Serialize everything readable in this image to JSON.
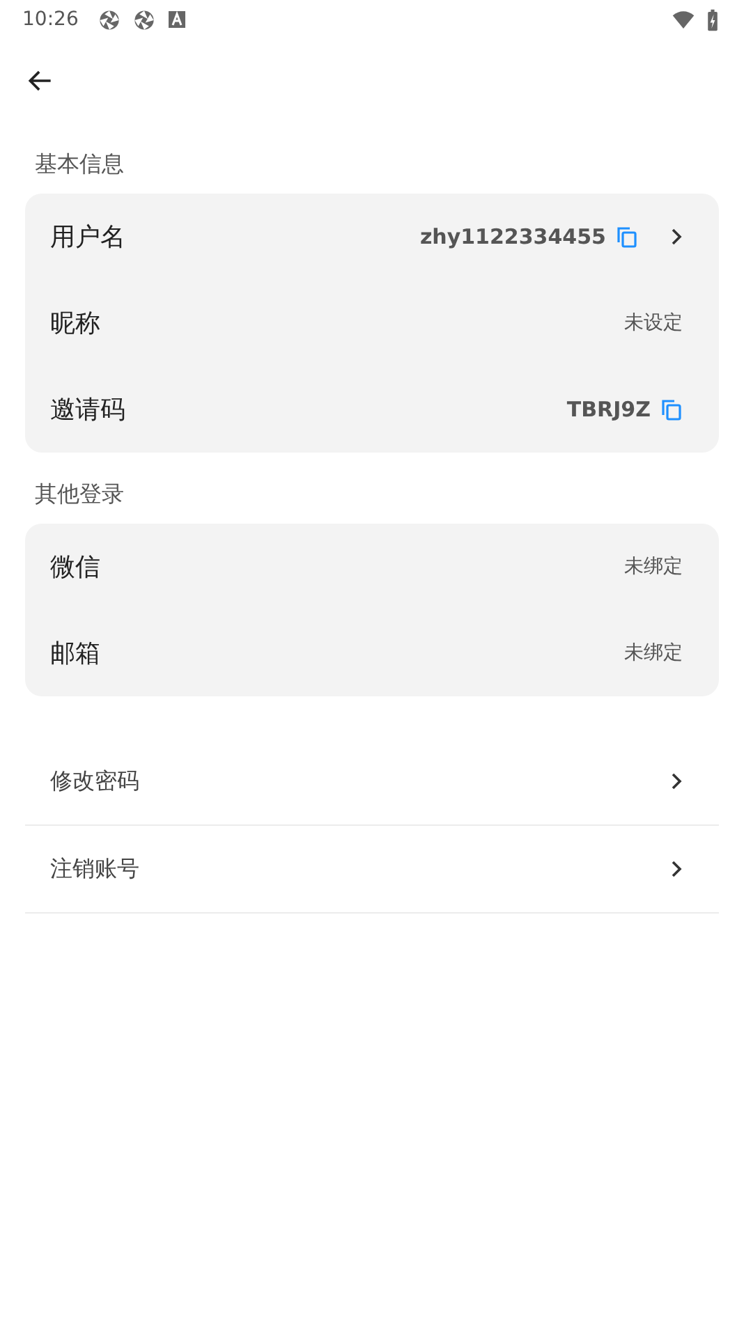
{
  "status_bar": {
    "time": "10:26"
  },
  "sections": [
    {
      "title": "基本信息",
      "rows": [
        {
          "label": "用户名",
          "value": "zhy1122334455",
          "copy": true,
          "chevron": true
        },
        {
          "label": "昵称",
          "value": "未设定",
          "copy": false,
          "chevron": false
        },
        {
          "label": "邀请码",
          "value": "TBRJ9Z",
          "copy": true,
          "chevron": false
        }
      ]
    },
    {
      "title": "其他登录",
      "rows": [
        {
          "label": "微信",
          "value": "未绑定",
          "copy": false,
          "chevron": false
        },
        {
          "label": "邮箱",
          "value": "未绑定",
          "copy": false,
          "chevron": false
        }
      ]
    }
  ],
  "actions": [
    {
      "label": "修改密码"
    },
    {
      "label": "注销账号"
    }
  ]
}
